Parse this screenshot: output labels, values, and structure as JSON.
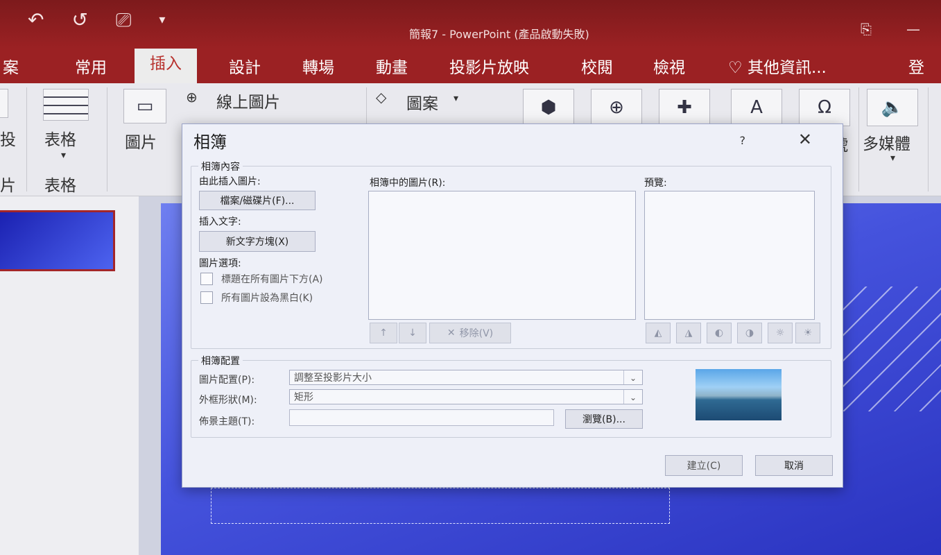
{
  "window": {
    "title": "簡報7 - PowerPoint (產品啟動失敗)",
    "qat": {
      "undo_icon": "↶",
      "redo_icon": "↺",
      "present_icon": "⎚",
      "more_icon": "▾"
    }
  },
  "tabs": [
    {
      "label": "案"
    },
    {
      "label": "常用"
    },
    {
      "label": "插入"
    },
    {
      "label": "設計"
    },
    {
      "label": "轉場"
    },
    {
      "label": "動畫"
    },
    {
      "label": "投影片放映"
    },
    {
      "label": "校閱"
    },
    {
      "label": "檢視"
    },
    {
      "label": "其他資訊..."
    },
    {
      "label": "登入"
    }
  ],
  "ribbon": {
    "slide_group_char1": "投",
    "slide_group_char2": "片",
    "table_label": "表格",
    "table_group_label": "表格",
    "pictures_label": "圖片",
    "online_pictures_label": "線上圖片",
    "shapes_label": "圖案",
    "symbols_partial": "號",
    "media_label": "多媒體"
  },
  "dialog": {
    "title": "相簿",
    "help": "?",
    "close": "✕",
    "content_group": "相簿內容",
    "insert_from_label": "由此插入圖片:",
    "file_disk_button": "檔案/磁碟片(F)...",
    "insert_text_label": "插入文字:",
    "new_textbox_button": "新文字方塊(X)",
    "picture_options_label": "圖片選項:",
    "caption_below": "標題在所有圖片下方(A)",
    "all_black_white": "所有圖片設為黑白(K)",
    "pictures_in_album_label": "相簿中的圖片(R):",
    "preview_label": "預覽:",
    "move_up": "↑",
    "move_down": "↓",
    "remove_button": "移除(V)",
    "layout_group": "相簿配置",
    "picture_layout_label": "圖片配置(P):",
    "picture_layout_value": "調整至投影片大小",
    "frame_shape_label": "外框形狀(M):",
    "frame_shape_value": "矩形",
    "theme_label": "佈景主題(T):",
    "theme_value": "",
    "browse_button": "瀏覽(B)...",
    "create_button": "建立(C)",
    "cancel_button": "取消"
  }
}
